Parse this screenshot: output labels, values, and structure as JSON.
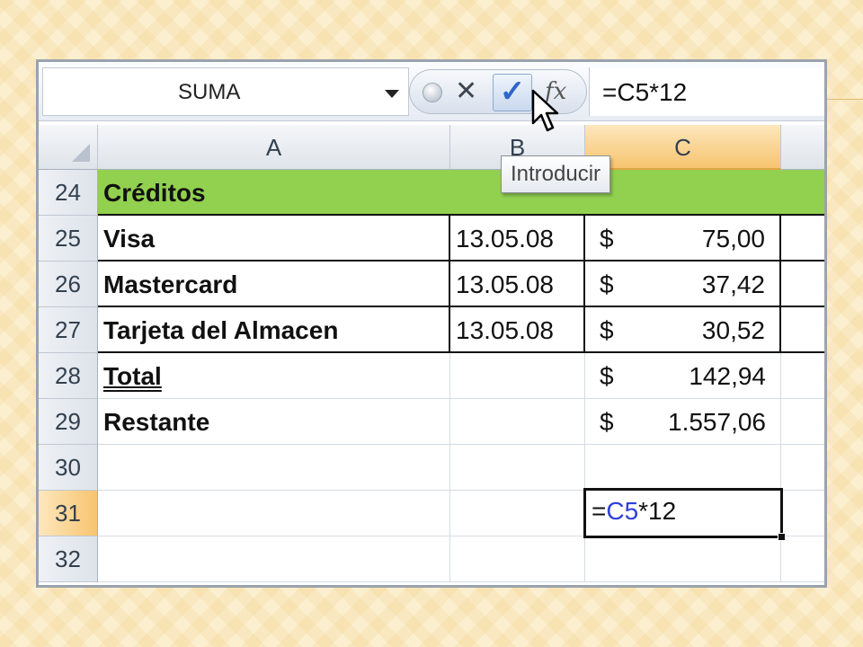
{
  "formula_bar": {
    "name_box": "SUMA",
    "cancel_glyph": "✕",
    "enter_glyph": "✓",
    "fx_label": "fx",
    "formula": "=C5*12"
  },
  "tooltip": "Introducir",
  "columns": [
    "A",
    "B",
    "C"
  ],
  "rows": [
    {
      "num": "24",
      "a": "Créditos"
    },
    {
      "num": "25",
      "a": "Visa",
      "b": "13.05.08",
      "cur": "$",
      "c": "75,00"
    },
    {
      "num": "26",
      "a": "Mastercard",
      "b": "13.05.08",
      "cur": "$",
      "c": "37,42"
    },
    {
      "num": "27",
      "a": "Tarjeta del Almacen",
      "b": "13.05.08",
      "cur": "$",
      "c": "30,52"
    },
    {
      "num": "28",
      "a": "Total",
      "cur": "$",
      "c": "142,94"
    },
    {
      "num": "29",
      "a": "Restante",
      "cur": "$",
      "c": "1.557,06"
    },
    {
      "num": "30"
    },
    {
      "num": "31"
    },
    {
      "num": "32"
    }
  ],
  "active_cell": {
    "prefix": "=",
    "ref": "C5",
    "suffix": "*12"
  },
  "colors": {
    "header_green": "#92d050",
    "active_header": "#f7c46f",
    "cell_reference": "#2f3fd8"
  }
}
